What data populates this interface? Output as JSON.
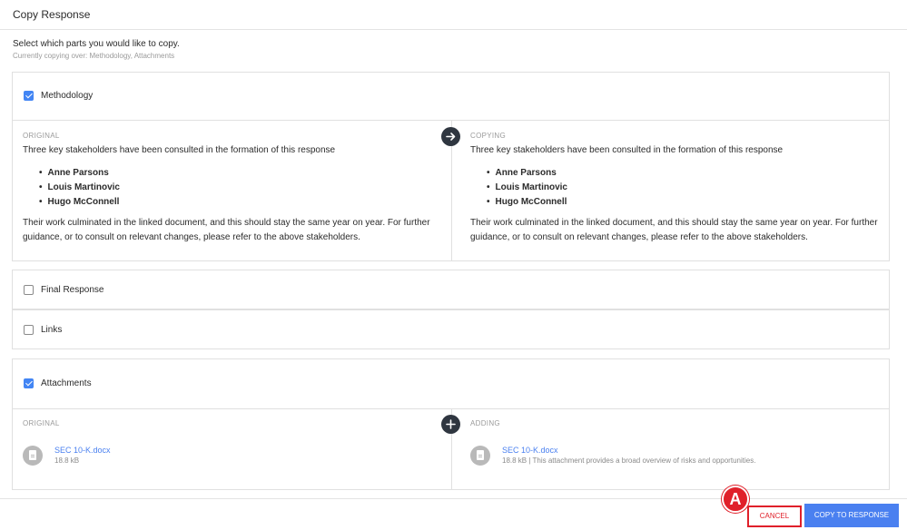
{
  "dialog": {
    "title": "Copy Response",
    "instruction": "Select which parts you would like to copy.",
    "currently_copying": "Currently copying over: Methodology, Attachments"
  },
  "sections": {
    "methodology": {
      "label": "Methodology",
      "checked": true,
      "left_heading": "ORIGINAL",
      "right_heading": "COPYING",
      "intro_text": "Three key stakeholders have been consulted in the formation of this response",
      "people": [
        "Anne Parsons",
        "Louis Martinovic",
        "Hugo McConnell"
      ],
      "closing_text": "Their work culminated in the linked document, and this should stay the same year on year. For further guidance, or to consult on relevant changes, please refer to the above stakeholders."
    },
    "final_response": {
      "label": "Final Response",
      "checked": false
    },
    "links": {
      "label": "Links",
      "checked": false
    },
    "attachments": {
      "label": "Attachments",
      "checked": true,
      "left_heading": "ORIGINAL",
      "right_heading": "ADDING",
      "file_name": "SEC 10-K.docx",
      "file_size": "18.8 kB",
      "file_size_with_desc": "18.8 kB | This attachment provides a broad overview of risks and opportunities."
    }
  },
  "footer": {
    "cancel_label": "CANCEL",
    "copy_label": "COPY TO RESPONSE"
  },
  "annotation": {
    "marker": "A"
  },
  "icons": {
    "arrow": "arrow-right-icon",
    "plus": "plus-icon",
    "file": "document-icon"
  },
  "colors": {
    "accent": "#4a80f0",
    "checkbox": "#4285f4",
    "highlight": "#e0202a"
  }
}
